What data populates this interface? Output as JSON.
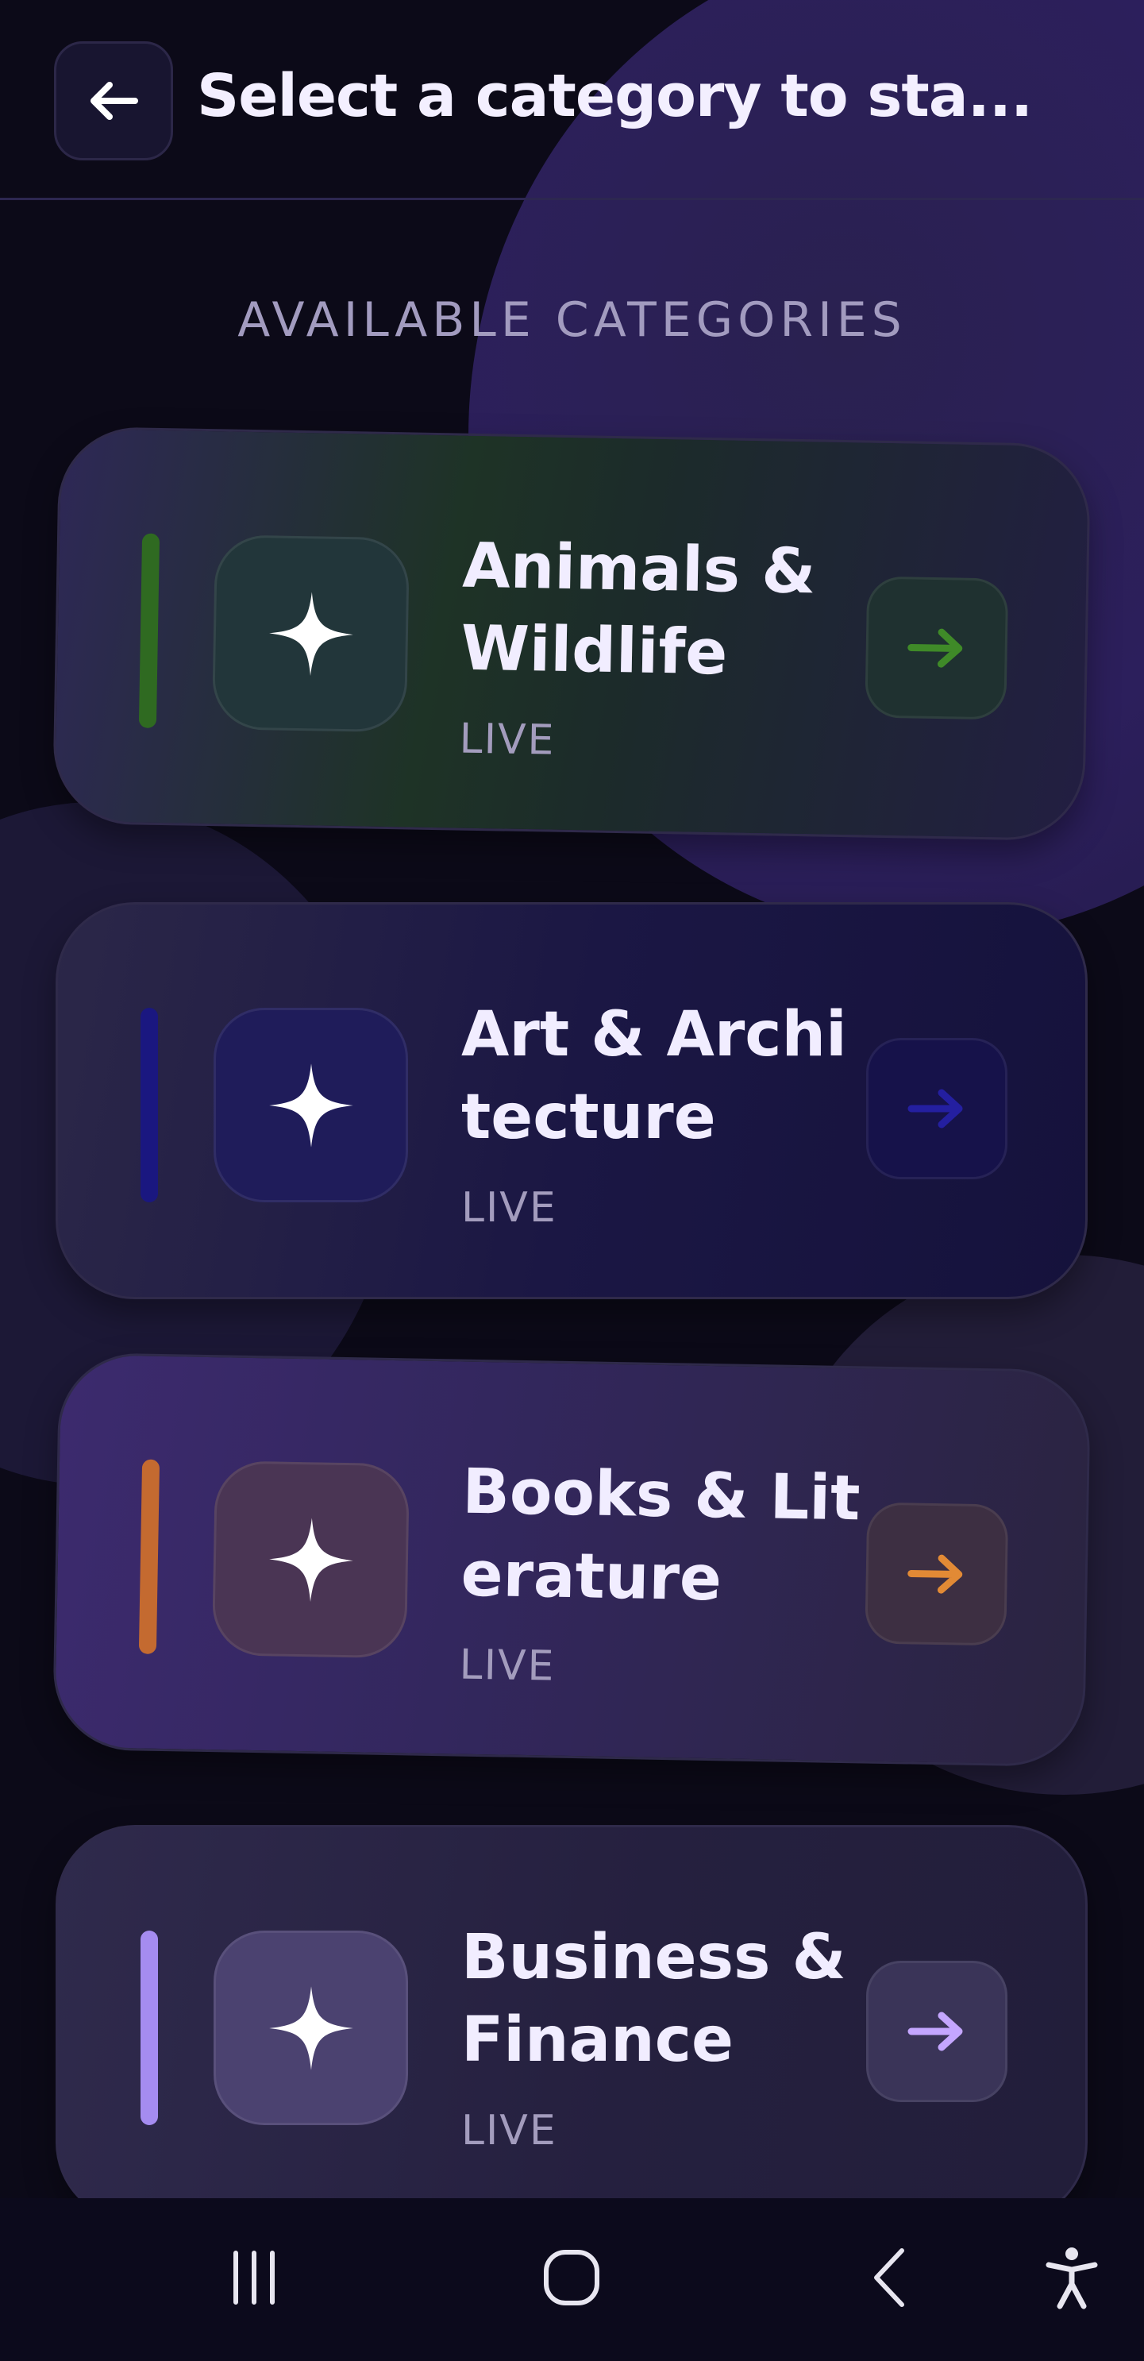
{
  "header": {
    "back_icon": "arrow-left-icon",
    "title": "Select a category to sta..."
  },
  "section_label": "AVAILABLE CATEGORIES",
  "categories": [
    {
      "name": "Animals & Wildlife",
      "status": "LIVE",
      "accent": "#2f6a21",
      "arrow_color": "#3f8a28",
      "icon": "sparkle-icon"
    },
    {
      "name": "Art & Archi tecture",
      "status": "LIVE",
      "accent": "#1a1780",
      "arrow_color": "#241fa0",
      "icon": "sparkle-icon"
    },
    {
      "name": "Books & Literature",
      "status": "LIVE",
      "accent": "#c46a30",
      "arrow_color": "#e28a35",
      "icon": "sparkle-icon"
    },
    {
      "name": "Business & Finance",
      "status": "LIVE",
      "accent": "#a58cf0",
      "arrow_color": "#c4a6ff",
      "icon": "sparkle-icon"
    }
  ],
  "system_nav": {
    "recents_icon": "recents-icon",
    "home_icon": "home-icon",
    "back_icon": "back-chevron-icon",
    "accessibility_icon": "accessibility-icon"
  }
}
